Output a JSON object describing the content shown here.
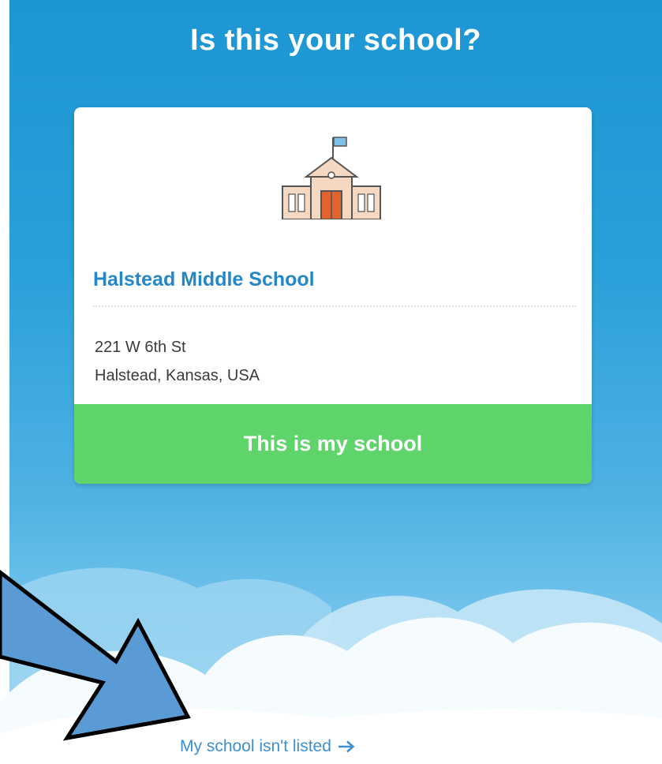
{
  "page": {
    "title": "Is this your school?"
  },
  "school_card": {
    "icon": "school-building-icon",
    "name": "Halstead Middle School",
    "address_line1": "221 W 6th St",
    "address_line2": "Halstead, Kansas, USA",
    "confirm_label": "This is my school"
  },
  "footer": {
    "not_listed_label": "My school isn't listed",
    "not_listed_icon": "arrow-right-icon"
  },
  "annotation": {
    "icon": "pointer-arrow-annotation"
  },
  "colors": {
    "sky_top": "#1d96d4",
    "school_name": "#2488c8",
    "confirm_button": "#5fd46b",
    "link": "#3d8fd0",
    "annotation_arrow": "#5b9bd5"
  }
}
